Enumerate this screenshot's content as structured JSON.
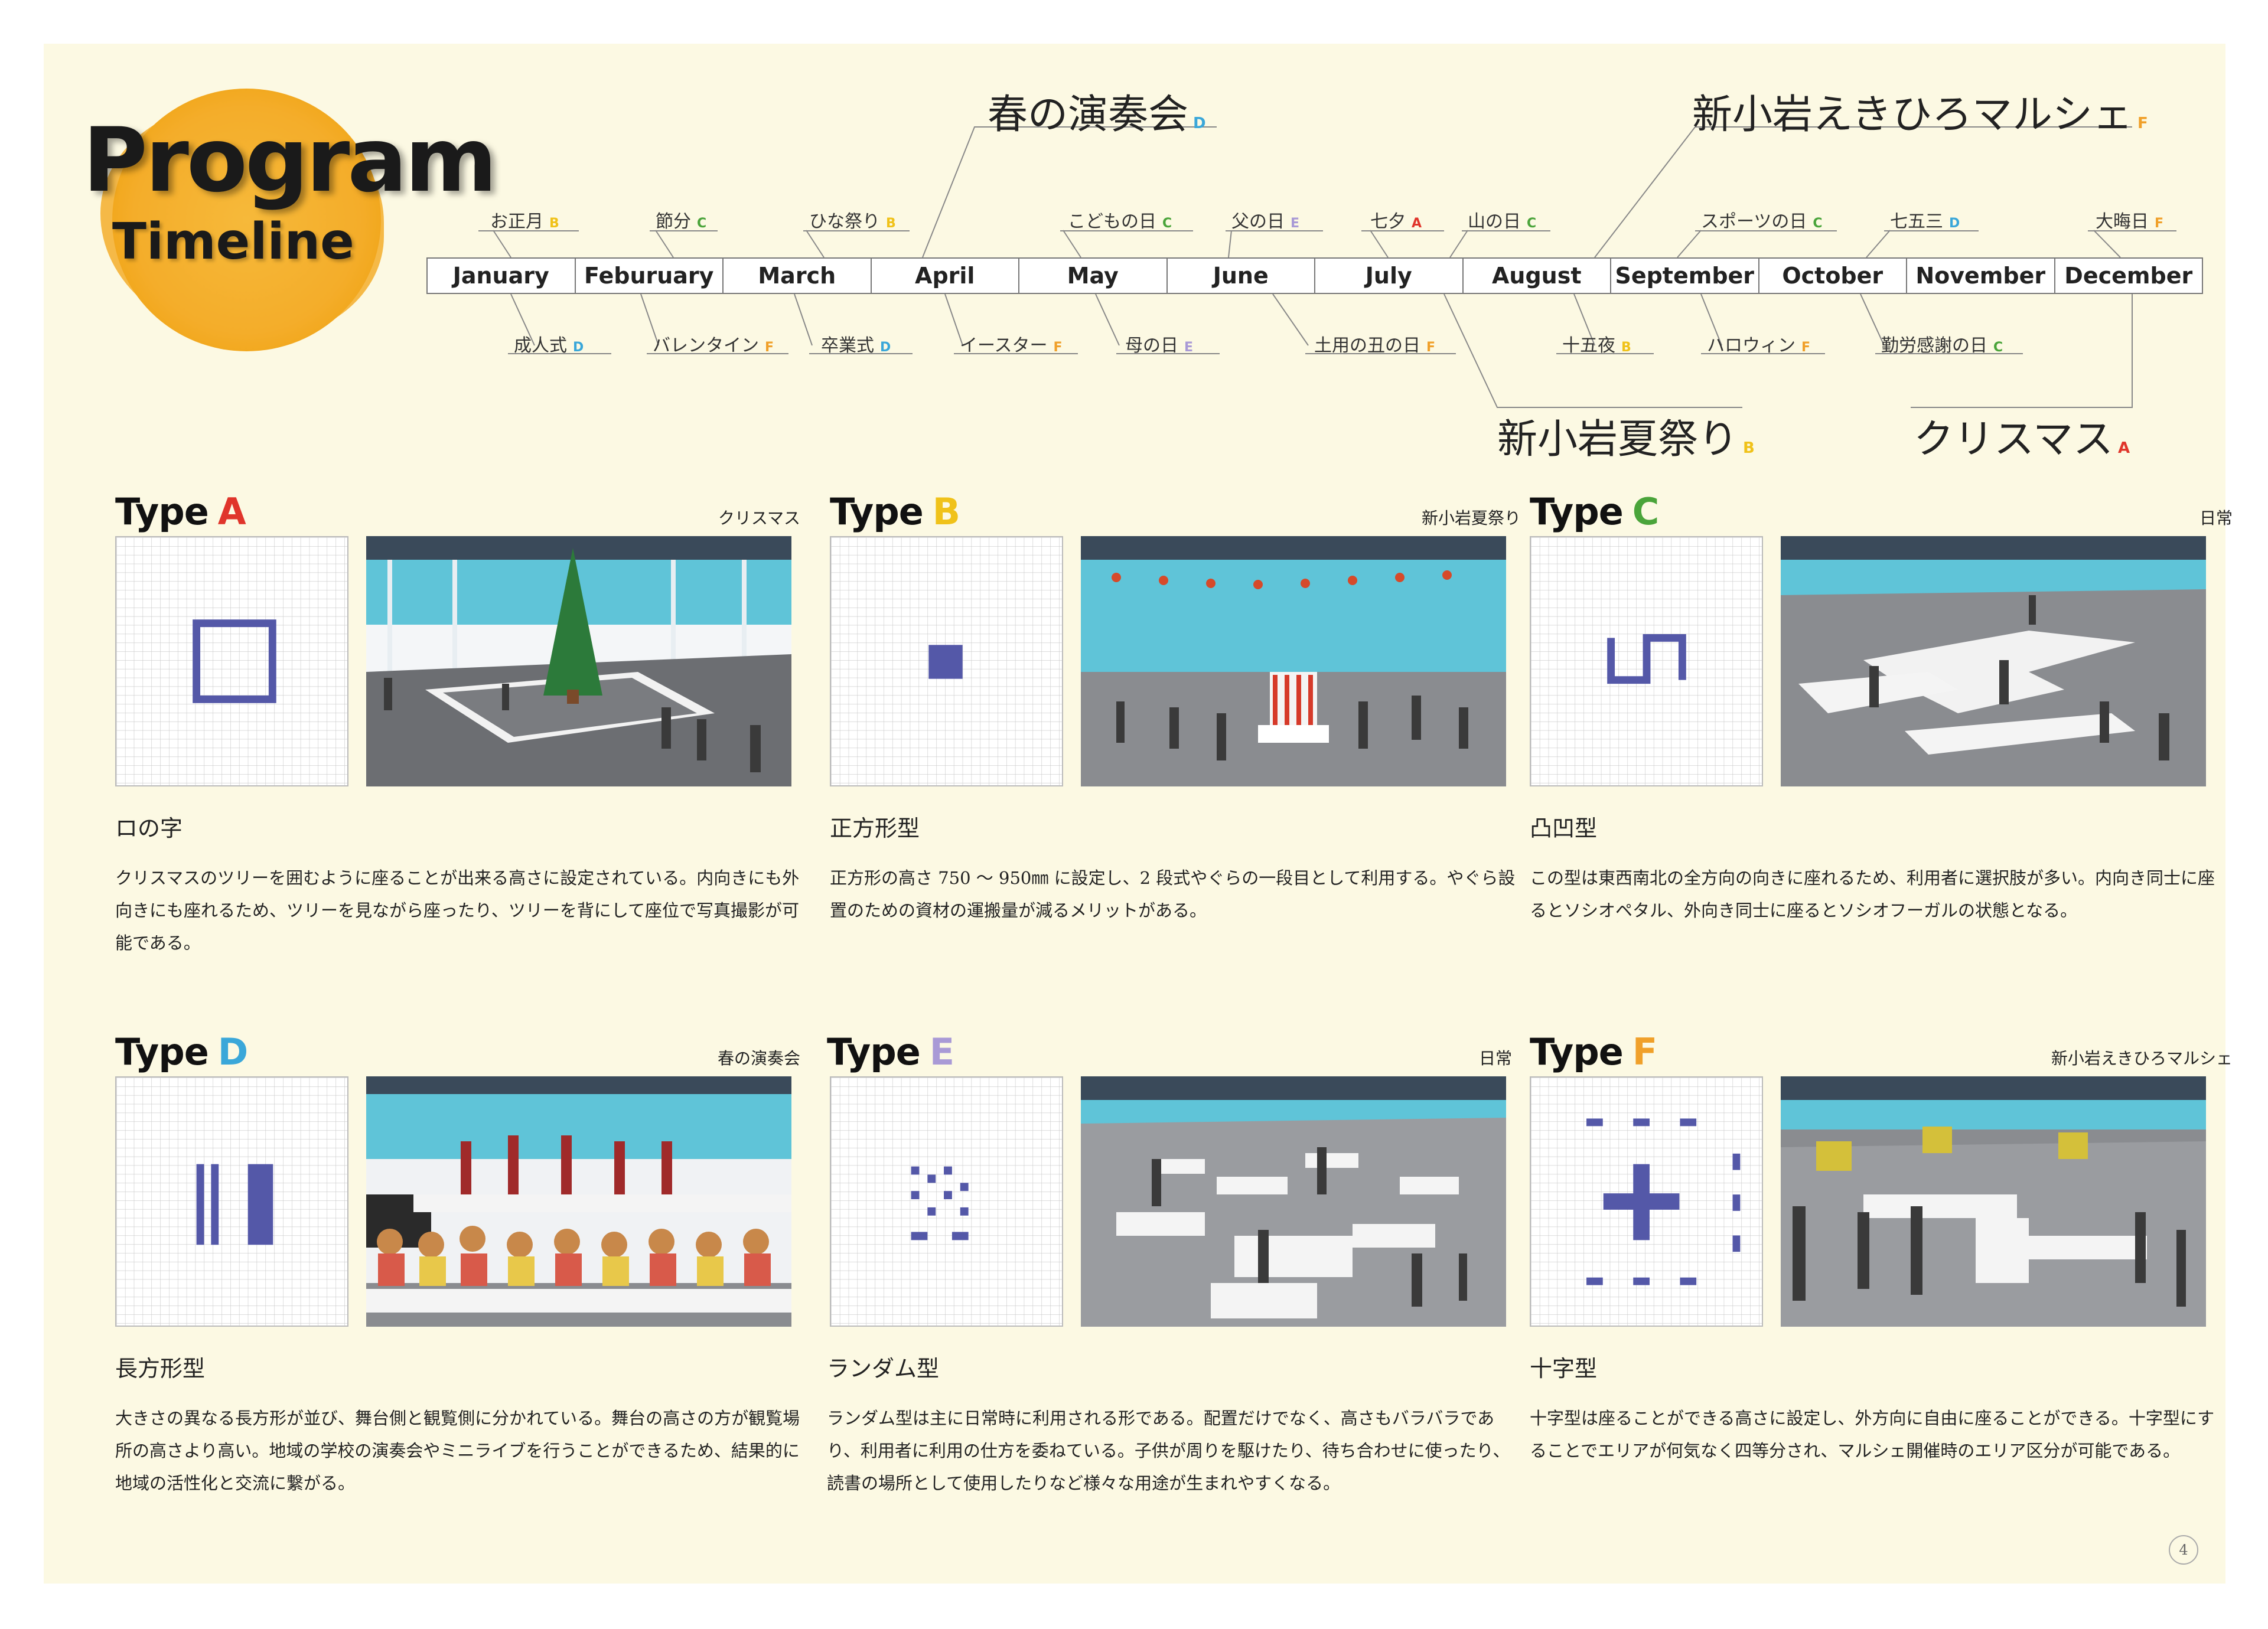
{
  "title": {
    "line1": "Program",
    "line2": "Timeline"
  },
  "months": [
    "January",
    "Feburuary",
    "March",
    "April",
    "May",
    "June",
    "July",
    "August",
    "September",
    "October",
    "November",
    "December"
  ],
  "events_top": [
    {
      "label": "お正月",
      "type": "B"
    },
    {
      "label": "節分",
      "type": "C"
    },
    {
      "label": "ひな祭り",
      "type": "B"
    },
    {
      "label": "こどもの日",
      "type": "C"
    },
    {
      "label": "父の日",
      "type": "E"
    },
    {
      "label": "七夕",
      "type": "A"
    },
    {
      "label": "山の日",
      "type": "C"
    },
    {
      "label": "スポーツの日",
      "type": "C"
    },
    {
      "label": "七五三",
      "type": "D"
    },
    {
      "label": "大晦日",
      "type": "F"
    }
  ],
  "events_bottom": [
    {
      "label": "成人式",
      "type": "D"
    },
    {
      "label": "バレンタイン",
      "type": "F"
    },
    {
      "label": "卒業式",
      "type": "D"
    },
    {
      "label": "イースター",
      "type": "F"
    },
    {
      "label": "母の日",
      "type": "E"
    },
    {
      "label": "土用の丑の日",
      "type": "F"
    },
    {
      "label": "十五夜",
      "type": "B"
    },
    {
      "label": "ハロウィン",
      "type": "F"
    },
    {
      "label": "勤労感謝の日",
      "type": "C"
    }
  ],
  "events_major": [
    {
      "label": "春の演奏会",
      "type": "D"
    },
    {
      "label": "新小岩えきひろマルシェ",
      "type": "F"
    },
    {
      "label": "新小岩夏祭り",
      "type": "B"
    },
    {
      "label": "クリスマス",
      "type": "A"
    }
  ],
  "type_word": "Type",
  "types": [
    {
      "letter": "A",
      "event": "クリスマス",
      "name": "ロの字",
      "desc": "クリスマスのツリーを囲むように座ることが出来る高さに設定されている。内向きにも外向きにも座れるため、ツリーを見ながら座ったり、ツリーを背にして座位で写真撮影が可能である。"
    },
    {
      "letter": "B",
      "event": "新小岩夏祭り",
      "name": "正方形型",
      "desc": "正方形の高さ 750 ～ 950㎜ に設定し、2 段式やぐらの一段目として利用する。やぐら設置のための資材の運搬量が減るメリットがある。"
    },
    {
      "letter": "C",
      "event": "日常",
      "name": "凸凹型",
      "desc": "この型は東西南北の全方向の向きに座れるため、利用者に選択肢が多い。内向き同士に座るとソシオペタル、外向き同士に座るとソシオフーガルの状態となる。"
    },
    {
      "letter": "D",
      "event": "春の演奏会",
      "name": "長方形型",
      "desc": "大きさの異なる長方形が並び、舞台側と観覧側に分かれている。舞台の高さの方が観覧場所の高さより高い。地域の学校の演奏会やミニライブを行うことができるため、結果的に地域の活性化と交流に繋がる。"
    },
    {
      "letter": "E",
      "event": "日常",
      "name": "ランダム型",
      "desc": "ランダム型は主に日常時に利用される形である。配置だけでなく、高さもバラバラであり、利用者に利用の仕方を委ねている。子供が周りを駆けたり、待ち合わせに使ったり、読書の場所として使用したりなど様々な用途が生まれやすくなる。"
    },
    {
      "letter": "F",
      "event": "新小岩えきひろマルシェ",
      "name": "十字型",
      "desc": "十字型は座ることができる高さに設定し、外方向に自由に座ることができる。十字型にすることでエリアが何気なく四等分され、マルシェ開催時のエリア区分が可能である。"
    }
  ],
  "type_colors": {
    "A": "#e0352b",
    "B": "#f0c21a",
    "C": "#4aa43a",
    "D": "#3aa7d9",
    "E": "#a99ad6",
    "F": "#f0a02a"
  },
  "page_number": "4"
}
